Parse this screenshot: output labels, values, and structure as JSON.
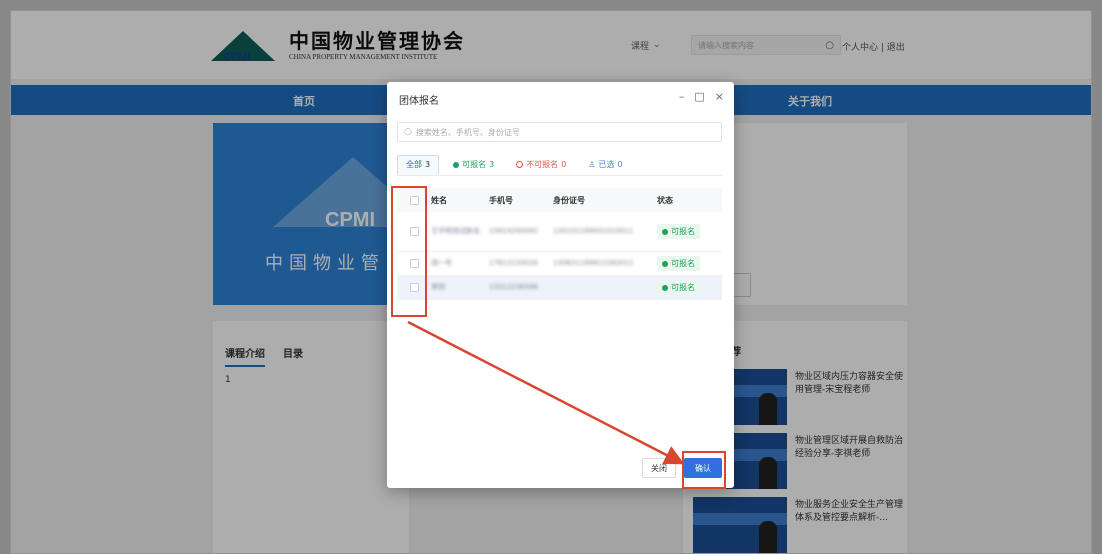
{
  "site": {
    "logo_mark": "CPMI",
    "name_cn": "中国物业管理协会",
    "name_en": "CHINA PROPERTY MANAGEMENT INSTITUTE",
    "search_category": "课程",
    "search_placeholder": "请输入搜索内容",
    "user_links": "个人中心 | 退出"
  },
  "nav": {
    "home": "首页",
    "about": "关于我们"
  },
  "banner": {
    "mark": "CPMI",
    "text": "中国物业管"
  },
  "course": {
    "tabs": [
      {
        "label": "课程介绍"
      },
      {
        "label": "目录"
      }
    ],
    "intro_text": "1"
  },
  "recommend": {
    "heading": "荐",
    "items": [
      {
        "title": "物业区域内压力容器安全使用管理-宋宝程老师"
      },
      {
        "title": "物业管理区域开展自救防治经验分享-李祺老师"
      },
      {
        "title": "物业服务企业安全生产管理体系及管控要点解析-..."
      }
    ]
  },
  "modal": {
    "title": "团体报名",
    "controls": {
      "minimize": "–",
      "maximize": "□",
      "close": "×"
    },
    "search_placeholder": "搜索姓名、手机号、身份证号",
    "filters": [
      {
        "label": "全部",
        "count": "3"
      },
      {
        "label": "可报名",
        "count": "3"
      },
      {
        "label": "不可报名",
        "count": "0"
      },
      {
        "label": "已选",
        "count": "0"
      }
    ],
    "columns": {
      "name": "姓名",
      "phone": "手机号",
      "id": "身份证号",
      "status": "状态"
    },
    "rows": [
      {
        "name": "王华明测试新名",
        "phone": "15814200082",
        "id": "120101199001010011",
        "status": "可报名"
      },
      {
        "name": "测一号",
        "phone": "17812220020",
        "id": "130621199812282012",
        "status": "可报名"
      },
      {
        "name": "李四",
        "phone": "13312236566",
        "id": "",
        "status": "可报名"
      }
    ],
    "buttons": {
      "close": "关闭",
      "confirm": "确认"
    }
  },
  "colors": {
    "brand_blue": "#1f6fc2",
    "confirm_blue": "#2f6fde",
    "ok_green": "#1aa260",
    "error_red": "#e4554a",
    "annotation_red": "#d9452f"
  }
}
